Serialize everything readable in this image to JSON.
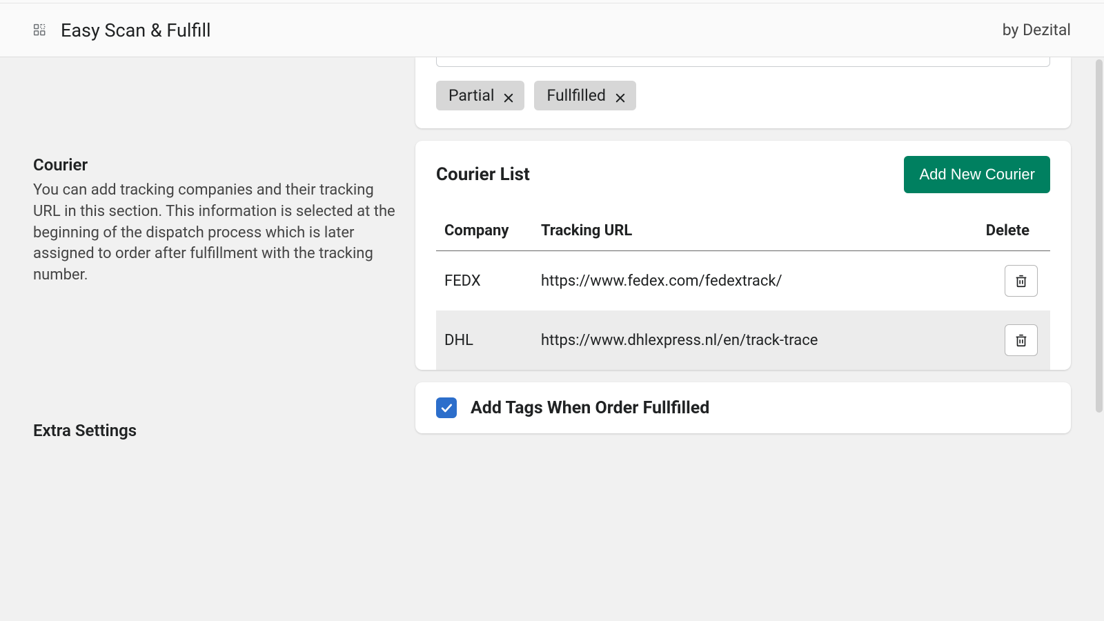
{
  "header": {
    "app_title": "Easy Scan & Fulfill",
    "vendor": "by Dezital"
  },
  "tags": {
    "items": [
      {
        "label": "Partial"
      },
      {
        "label": "Fullfilled"
      }
    ]
  },
  "courier_section": {
    "title": "Courier",
    "description": "You can add tracking companies and their tracking URL in this section. This information is selected at the beginning of the dispatch process which is later assigned to order after fulfillment with the tracking number."
  },
  "courier_list": {
    "title": "Courier List",
    "add_button": "Add New Courier",
    "columns": {
      "company": "Company",
      "tracking_url": "Tracking URL",
      "delete": "Delete"
    },
    "rows": [
      {
        "company": "FEDX",
        "url": "https://www.fedex.com/fedextrack/"
      },
      {
        "company": "DHL",
        "url": "https://www.dhlexpress.nl/en/track-trace"
      }
    ]
  },
  "extra_settings": {
    "title": "Extra Settings",
    "checkbox_label": "Add Tags When Order Fullfilled",
    "checked": true
  }
}
